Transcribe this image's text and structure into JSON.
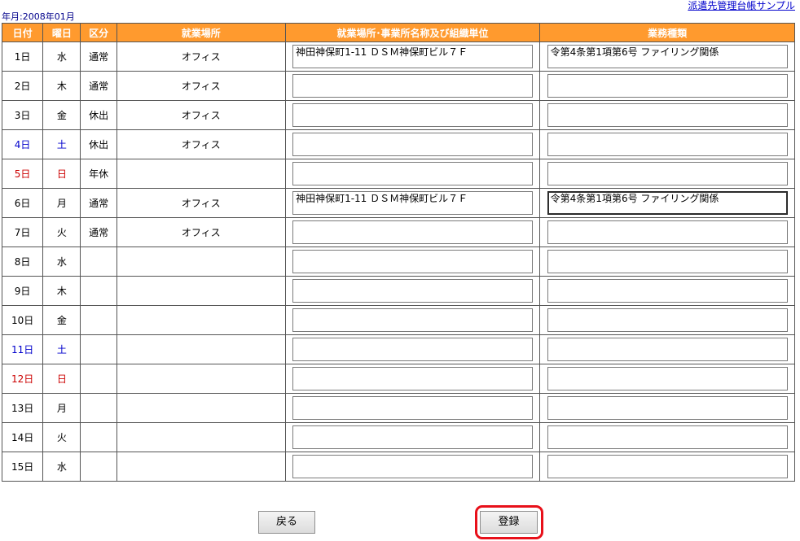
{
  "header": {
    "sample_link": "派遣先管理台帳サンプル",
    "year_month": "年月:2008年01月"
  },
  "table": {
    "columns": [
      "日付",
      "曜日",
      "区分",
      "就業場所",
      "就業場所･事業所名称及び組織単位",
      "業務種類"
    ],
    "rows": [
      {
        "day": "1日",
        "dow": "水",
        "kbn": "通常",
        "loc": "オフィス",
        "addr": "神田神保町1-11 ＤＳＭ神保町ビル７Ｆ",
        "work": "令第4条第1項第6号 ファイリング関係"
      },
      {
        "day": "2日",
        "dow": "木",
        "kbn": "通常",
        "loc": "オフィス",
        "addr": "",
        "work": ""
      },
      {
        "day": "3日",
        "dow": "金",
        "kbn": "休出",
        "loc": "オフィス",
        "addr": "",
        "work": ""
      },
      {
        "day": "4日",
        "dow": "土",
        "kbn": "休出",
        "loc": "オフィス",
        "addr": "",
        "work": ""
      },
      {
        "day": "5日",
        "dow": "日",
        "kbn": "年休",
        "loc": "",
        "addr": "",
        "work": ""
      },
      {
        "day": "6日",
        "dow": "月",
        "kbn": "通常",
        "loc": "オフィス",
        "addr": "神田神保町1-11 ＤＳＭ神保町ビル７Ｆ",
        "work": "令第4条第1項第6号 ファイリング関係"
      },
      {
        "day": "7日",
        "dow": "火",
        "kbn": "通常",
        "loc": "オフィス",
        "addr": "",
        "work": ""
      },
      {
        "day": "8日",
        "dow": "水",
        "kbn": "",
        "loc": "",
        "addr": "",
        "work": ""
      },
      {
        "day": "9日",
        "dow": "木",
        "kbn": "",
        "loc": "",
        "addr": "",
        "work": ""
      },
      {
        "day": "10日",
        "dow": "金",
        "kbn": "",
        "loc": "",
        "addr": "",
        "work": ""
      },
      {
        "day": "11日",
        "dow": "土",
        "kbn": "",
        "loc": "",
        "addr": "",
        "work": ""
      },
      {
        "day": "12日",
        "dow": "日",
        "kbn": "",
        "loc": "",
        "addr": "",
        "work": ""
      },
      {
        "day": "13日",
        "dow": "月",
        "kbn": "",
        "loc": "",
        "addr": "",
        "work": ""
      },
      {
        "day": "14日",
        "dow": "火",
        "kbn": "",
        "loc": "",
        "addr": "",
        "work": ""
      },
      {
        "day": "15日",
        "dow": "水",
        "kbn": "",
        "loc": "",
        "addr": "",
        "work": ""
      }
    ]
  },
  "buttons": {
    "back": "戻る",
    "register": "登録"
  },
  "colors": {
    "header_bg": "#ff9a2e",
    "saturday": "#0000cc",
    "sunday": "#cc0000",
    "highlight": "#e8101a"
  }
}
